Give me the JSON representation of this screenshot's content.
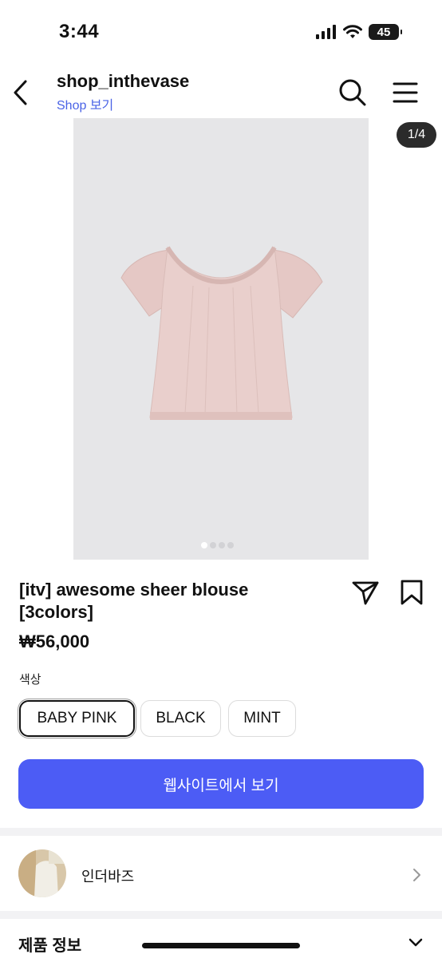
{
  "status_bar": {
    "time": "3:44",
    "battery": "45"
  },
  "header": {
    "shop_name": "shop_inthevase",
    "shop_link": "Shop 보기"
  },
  "gallery": {
    "pager": "1/4",
    "current_index": 1,
    "total": 4
  },
  "product": {
    "title_line1": "[itv] awesome sheer blouse",
    "title_line2": "[3colors]",
    "price": "₩56,000",
    "color_label": "색상",
    "options": [
      "BABY PINK",
      "BLACK",
      "MINT"
    ],
    "selected_option": "BABY PINK",
    "cta": "웹사이트에서 보기"
  },
  "seller": {
    "name": "인더바즈"
  },
  "section": {
    "title": "제품 정보"
  },
  "colors": {
    "accent": "#4c5cf5",
    "link": "#4a63e6",
    "product_pink": "#e8cdca"
  }
}
